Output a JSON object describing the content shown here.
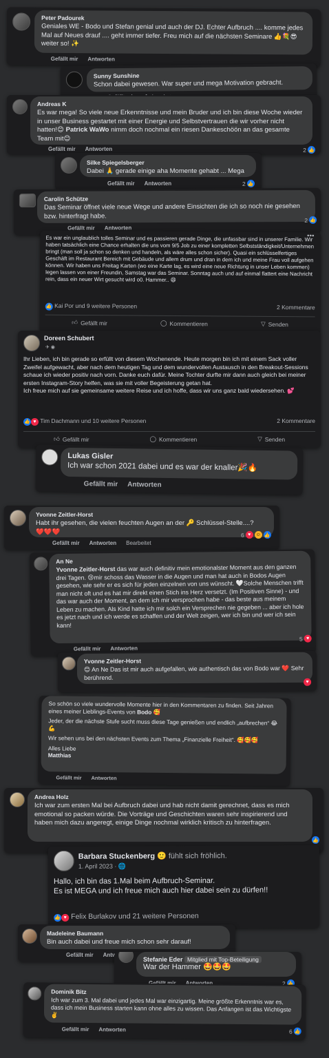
{
  "common": {
    "like": "Gefällt mir",
    "reply": "Antworten",
    "edited": "Bearbeitet",
    "comment": "Kommentieren",
    "send": "Senden"
  },
  "c1": {
    "name": "Peter Padourek",
    "text": "Geniales WE - Bodo und Stefan genial und auch der DJ. Echter Aufbruch .... komme jedes Mal auf Neues drauf .... geht immer tiefer. Freu mich auf die nächsten Seminare 👍💐😎 weiter so! ✨"
  },
  "c2": {
    "name": "Sunny Sunshine",
    "text": "Schon dabei gewesen. War super und mega Motivation gebracht."
  },
  "c3": {
    "name": "Andreas K",
    "text_a": "Es war mega! So viele neue Erkenntnisse und mein Bruder und ich bin diese Woche wieder in unser Business gestartet mit einer Energie und Selbstvertrauen die wir vorher nicht hatten!😊 ",
    "mention": "Patrick WaWo",
    "text_b": " nimm doch nochmal ein riesen Dankeschöön an das gesamte Team mit😊",
    "count": "2"
  },
  "c4": {
    "name": "Silke Spiegelsberger",
    "text": "Dabei 🙏 gerade einige aha Momente gehabt ... Mega",
    "count": "2"
  },
  "c5": {
    "name": "Carolin Schütze",
    "text": "Das Seminar öffnet viele neue Wege und andere Einsichten die ich so noch nie gesehen bzw. hinterfragt habe.",
    "count": "2"
  },
  "p1": {
    "text": "Es war ein unglaublich tolles Seminar und es passieren gerade Dinge, die unfassbar sind in unserer Familie. Wir haben tatsächlich eine Chance erhalten die uns vom 9/5 Job zu einer kompletten Selbstständigkeit/Unternehmen bringt (man soll ja schon so denken und handeln, als wäre alles schon sicher). Quasi ein schlüsselfertiges Geschäft im Restaurant Bereich mit Gebäude und allem drum und dran in dem ich und meine Frau voll aufgehen können. Wir haben uns Freitag Karten (wo eine Karte lag, es wird eine neue Richtung in unser Leben kommen) legen lassen von einer Freundin, Samstag war das Seminar. Sonntag auch und auf einmal flattert eine Nachricht rein, dass ein neuer Wirt gesucht wird o0. Hammer.. 😄",
    "reactions": "Kai Por und 9 weitere Personen",
    "comments": "2 Kommentare"
  },
  "p2": {
    "name": "Doreen Schubert",
    "text": "Ihr Lieben, ich bin gerade so erfüllt von diesem Wochenende.  Heute morgen bin ich mit einem Sack voller Zweifel aufgewacht, aber nach dem heutigen Tag und dem wundervollen Austausch in den Breakout-Sessions schaue ich wieder positiv nach vorn. Danke euch dafür. Meine Tochter durfte mir dann auch gleich bei meiner ersten Instagram-Story helfen, was sie mit voller Begeisterung getan hat.\nIch freue mich auf sie gemeinsame weitere Reise und ich hoffe, dass wir uns ganz bald wiedersehen. 💕",
    "reactions": "Tim Dachmann und 10 weitere Personen",
    "comments": "2 Kommentare"
  },
  "c6": {
    "name": "Lukas Gisler",
    "text": "Ich war schon 2021 dabei und es war der knaller🎉🔥"
  },
  "c7": {
    "name": "Yvonne Zeitler-Horst",
    "text": "Habt ihr gesehen, die vielen feuchten Augen an der 🔑 Schlüssel-Stelle....?\n❤️❤️❤️",
    "count": "6"
  },
  "c8": {
    "name": "An Ne",
    "mention": "Yvonne Zeitler-Horst",
    "text": " das war auch definitiv mein emotionalster Moment aus den ganzen drei Tagen. 😢mir schoss das Wasser in die Augen und man hat auch in Bodos Augen gesehen, wie sehr er es sich für jeden einzelnen von uns wünscht. 🤍Solche Menschen trifft man nicht oft und es hat mir direkt einen Stich ins Herz versetzt. (Im Positiven Sinne) - und das war auch der Moment, an dem ich mir versprochen habe - das beste aus meinem Leben zu machen. Als Kind hatte ich mir solch ein Versprechen nie gegeben ... aber ich hole es jetzt nach und ich werde es schaffen und der Welt zeigen, wer ich bin und wer ich sein kann!",
    "count": "5"
  },
  "c9": {
    "name": "Yvonne Zeitler-Horst",
    "text": "😊 An Ne Das ist mir auch aufgefallen, wie authentisch das von Bodo war ❤️ Sehr berührend."
  },
  "c10": {
    "text_a": "So schön so viele wundervolle Momente hier in den Kommentaren zu finden. Seit Jahren eines meiner Lieblings-Events von ",
    "mention": "Bodo",
    "text_b": " 🥰",
    "line2": "Jeder, der die nächste Stufe sucht muss diese Tage genießen und endlich „aufbrechen“ 😂💪",
    "line3": "Wir sehen uns bei den nächsten Events zum Thema „Finanzielle Freiheit“. 🥰🥰🥰",
    "line4": "Alles Liebe",
    "line5": "Matthias"
  },
  "c11": {
    "name": "Andrea Holz",
    "text": "Ich war zum ersten Mal bei Aufbruch dabei und hab nicht damit gerechnet, dass es mich emotional so packen würde. Die Vorträge und Geschichten waren sehr inspirierend und haben mich dazu angeregt, einige Dinge nochmal wirklich kritisch zu hinterfragen."
  },
  "p3": {
    "name": "Barbara Stuckenberg",
    "feeling": "fühlt sich fröhlich.",
    "date": "1. April 2023 · 🌐",
    "text": "Hallo, ich bin das 1.Mal beim Aufbruch-Seminar.\nEs ist MEGA und ich freue mich auch hier dabei sein zu dürfen!!",
    "reactions": "Felix Burlakov und 21 weitere Personen"
  },
  "c12": {
    "name": "Madeleine Baumann",
    "text": "Bin auch dabei und freue mich schon sehr darauf!"
  },
  "c13": {
    "name": "Stefanie Eder",
    "badge": "Mitglied mit Top-Beteiligung",
    "text": "War der Hammer 🤩🤩🤩",
    "count": "2"
  },
  "c14": {
    "name": "Dominik Bitz",
    "text": "Ich war zum 3. Mal dabei und jedes Mal war einzigartig. Meine größte Erkenntnis war es, dass ich mein Business starten kann ohne alles zu wissen. Das Anfangen ist das Wichtigste ✌️",
    "count": "6"
  }
}
